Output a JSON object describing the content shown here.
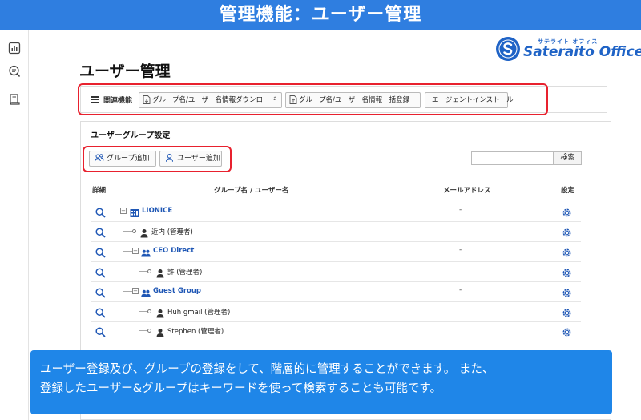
{
  "banner": {
    "title": "管理機能：ユーザー管理"
  },
  "logo": {
    "small": "サテライト オフィス",
    "text": "Sateraito Office"
  },
  "page": {
    "title": "ユーザー管理"
  },
  "related": {
    "label": "関連機能",
    "buttons": [
      "グループ名/ユーザー名情報ダウンロード",
      "グループ名/ユーザー名情報一括登録",
      "エージェントインストール"
    ]
  },
  "panel": {
    "title": "ユーザーグループ設定",
    "add_group": "グループ追加",
    "add_user": "ユーザー追加",
    "search_button": "検索",
    "search_placeholder": ""
  },
  "table": {
    "headers": {
      "detail": "詳細",
      "name": "グループ名 / ユーザー名",
      "email": "メールアドレス",
      "settings": "設定"
    },
    "rows": [
      {
        "name": "LIONICE",
        "type": "root",
        "email": "-"
      },
      {
        "name": "近内 (管理者)",
        "type": "user",
        "email": ""
      },
      {
        "name": "CEO Direct",
        "type": "group",
        "email": "-"
      },
      {
        "name": "許 (管理者)",
        "type": "user",
        "email": ""
      },
      {
        "name": "Guest Group",
        "type": "group",
        "email": "-"
      },
      {
        "name": "Huh gmail (管理者)",
        "type": "user",
        "email": ""
      },
      {
        "name": "Stephen (管理者)",
        "type": "user",
        "email": ""
      }
    ]
  },
  "caption": {
    "line1": "ユーザー登録及び、グループの登録をして、階層的に管理することができます。 また、",
    "line2": "登録したユーザー&グループはキーワードを使って検索することも可能です。"
  },
  "colors": {
    "banner": "#2f7ee0",
    "accent": "#1f57b5",
    "highlight": "#e8212e",
    "caption": "#1f86e8"
  },
  "icons": [
    "chart-icon",
    "search-list-icon",
    "document-icon",
    "magnifier-icon",
    "gear-icon",
    "user-icon",
    "group-icon"
  ]
}
